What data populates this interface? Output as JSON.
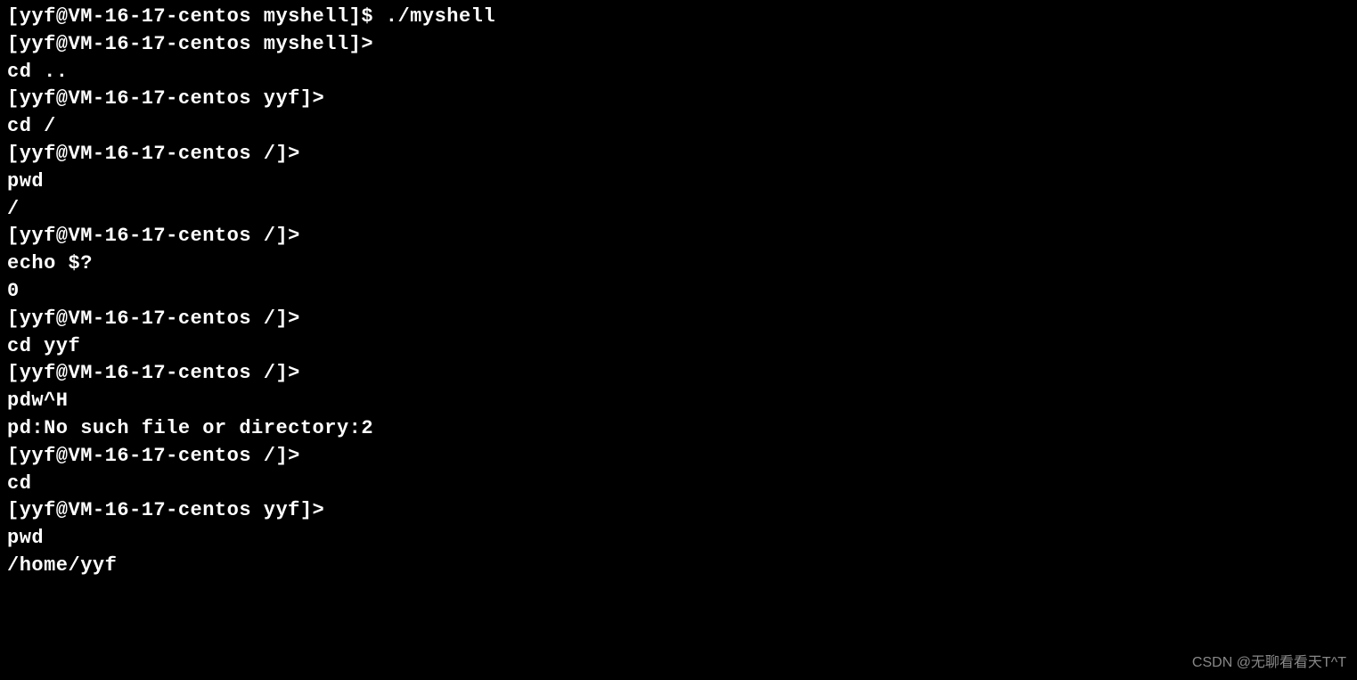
{
  "terminal": {
    "lines": [
      "[yyf@VM-16-17-centos myshell]$ ./myshell",
      "[yyf@VM-16-17-centos myshell]>",
      "cd ..",
      "[yyf@VM-16-17-centos yyf]>",
      "cd /",
      "[yyf@VM-16-17-centos /]>",
      "pwd",
      "/",
      "[yyf@VM-16-17-centos /]>",
      "echo $?",
      "0",
      "[yyf@VM-16-17-centos /]>",
      "cd yyf",
      "[yyf@VM-16-17-centos /]>",
      "pdw^H",
      "pd:No such file or directory:2",
      "[yyf@VM-16-17-centos /]>",
      "cd",
      "[yyf@VM-16-17-centos yyf]>",
      "pwd",
      "/home/yyf"
    ]
  },
  "watermark": "CSDN @无聊看看天T^T"
}
